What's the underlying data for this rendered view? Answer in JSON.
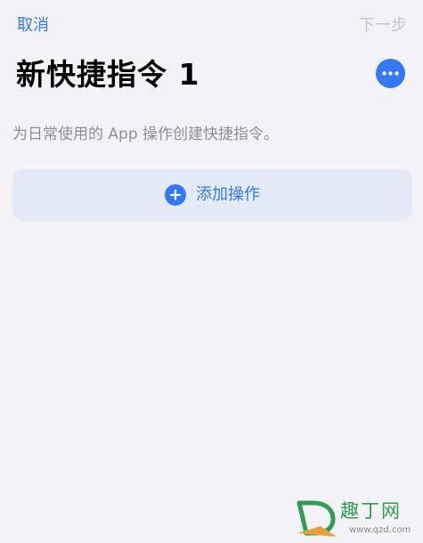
{
  "nav": {
    "cancel_label": "取消",
    "next_label": "下一步"
  },
  "header": {
    "title": "新快捷指令 1",
    "more_icon": "ellipsis-icon"
  },
  "main": {
    "description": "为日常使用的 App 操作创建快捷指令。",
    "add_action_label": "添加操作",
    "add_action_icon": "plus-circle-icon"
  },
  "watermark": {
    "text": "趣丁网",
    "url": "www.qzd.com"
  },
  "colors": {
    "accent": "#3478f6",
    "background": "#f2f2f7",
    "disabled_text": "#c5c5cc",
    "secondary_text": "#8e8e93",
    "add_action_background": "#e3eaf6"
  }
}
